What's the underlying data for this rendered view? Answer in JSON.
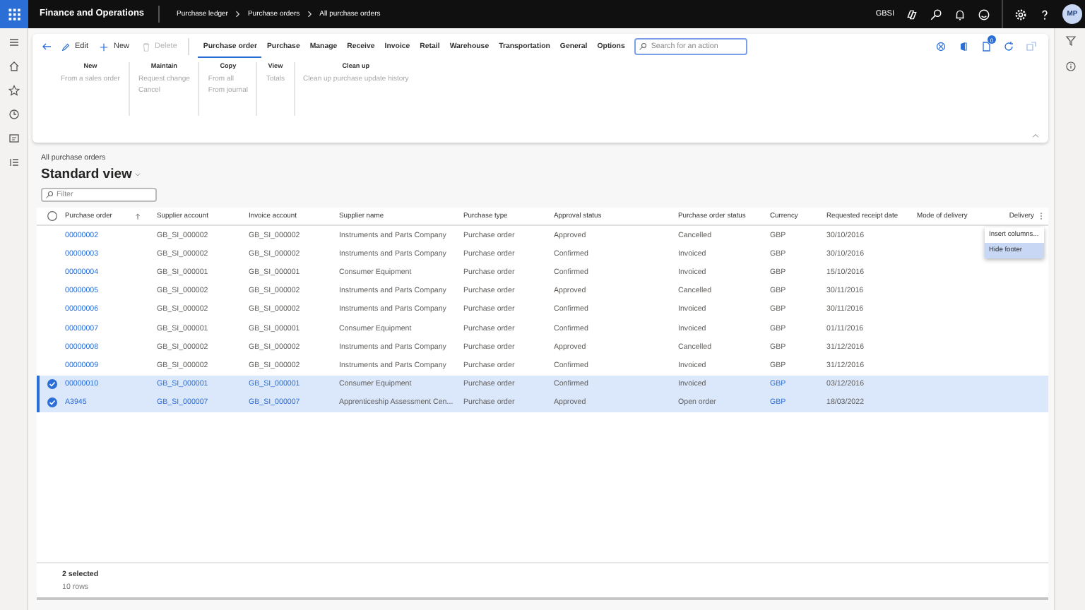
{
  "app_bar": {
    "app_name": "Finance and Operations",
    "breadcrumb": [
      "Purchase ledger",
      "Purchase orders",
      "All purchase orders"
    ],
    "company": "GBSI",
    "avatar": "MP",
    "notification_count": "0"
  },
  "action_pane": {
    "commands": [
      {
        "kind": "edit",
        "label": "Edit",
        "disabled": false
      },
      {
        "kind": "new",
        "label": "New",
        "disabled": false
      },
      {
        "kind": "delete",
        "label": "Delete",
        "disabled": true
      }
    ],
    "tabs": [
      {
        "label": "Purchase order",
        "selected": true
      },
      {
        "label": "Purchase",
        "selected": false
      },
      {
        "label": "Manage",
        "selected": false
      },
      {
        "label": "Receive",
        "selected": false
      },
      {
        "label": "Invoice",
        "selected": false
      },
      {
        "label": "Retail",
        "selected": false
      },
      {
        "label": "Warehouse",
        "selected": false
      },
      {
        "label": "Transportation",
        "selected": false
      },
      {
        "label": "General",
        "selected": false
      },
      {
        "label": "Options",
        "selected": false
      }
    ],
    "search": {
      "placeholder": "Search for an action"
    },
    "groups": [
      {
        "title": "New",
        "items": [
          {
            "label": "From a sales order",
            "disabled": true
          }
        ]
      },
      {
        "title": "Maintain",
        "items": [
          {
            "label": "Request change",
            "disabled": true
          },
          {
            "label": "Cancel",
            "disabled": true
          }
        ]
      },
      {
        "title": "Copy",
        "items": [
          {
            "label": "From all",
            "disabled": true
          },
          {
            "label": "From journal",
            "disabled": true
          }
        ]
      },
      {
        "title": "View",
        "items": [
          {
            "label": "Totals",
            "disabled": true
          }
        ]
      },
      {
        "title": "Clean up",
        "items": [
          {
            "label": "Clean up purchase update history",
            "disabled": true
          }
        ]
      }
    ]
  },
  "page": {
    "caption": "All purchase orders",
    "view": "Standard view",
    "filter": {
      "placeholder": "Filter"
    }
  },
  "grid": {
    "all_checked": false,
    "columns": [
      {
        "label": "Purchase order",
        "sorted": true
      },
      {
        "label": "Supplier account"
      },
      {
        "label": "Invoice account"
      },
      {
        "label": "Supplier name"
      },
      {
        "label": "Purchase type"
      },
      {
        "label": "Approval status"
      },
      {
        "label": "Purchase order status"
      },
      {
        "label": "Currency"
      },
      {
        "label": "Requested receipt date"
      },
      {
        "label": "Mode of delivery"
      },
      {
        "label": "Delivery"
      }
    ],
    "rows": [
      {
        "selected": false,
        "cells": [
          "00000002",
          "GB_SI_000002",
          "GB_SI_000002",
          "Instruments and Parts Company",
          "Purchase order",
          "Approved",
          "Cancelled",
          "GBP",
          "30/10/2016"
        ]
      },
      {
        "selected": false,
        "cells": [
          "00000003",
          "GB_SI_000002",
          "GB_SI_000002",
          "Instruments and Parts Company",
          "Purchase order",
          "Confirmed",
          "Invoiced",
          "GBP",
          "30/10/2016"
        ]
      },
      {
        "selected": false,
        "cells": [
          "00000004",
          "GB_SI_000001",
          "GB_SI_000001",
          "Consumer Equipment",
          "Purchase order",
          "Confirmed",
          "Invoiced",
          "GBP",
          "15/10/2016"
        ]
      },
      {
        "selected": false,
        "cells": [
          "00000005",
          "GB_SI_000002",
          "GB_SI_000002",
          "Instruments and Parts Company",
          "Purchase order",
          "Approved",
          "Cancelled",
          "GBP",
          "30/11/2016"
        ]
      },
      {
        "selected": false,
        "cells": [
          "00000006",
          "GB_SI_000002",
          "GB_SI_000002",
          "Instruments and Parts Company",
          "Purchase order",
          "Confirmed",
          "Invoiced",
          "GBP",
          "30/11/2016"
        ]
      },
      {
        "selected": false,
        "cells": [
          "00000007",
          "GB_SI_000001",
          "GB_SI_000001",
          "Consumer Equipment",
          "Purchase order",
          "Confirmed",
          "Invoiced",
          "GBP",
          "01/11/2016"
        ]
      },
      {
        "selected": false,
        "cells": [
          "00000008",
          "GB_SI_000002",
          "GB_SI_000002",
          "Instruments and Parts Company",
          "Purchase order",
          "Approved",
          "Cancelled",
          "GBP",
          "31/12/2016"
        ]
      },
      {
        "selected": false,
        "cells": [
          "00000009",
          "GB_SI_000002",
          "GB_SI_000002",
          "Instruments and Parts Company",
          "Purchase order",
          "Confirmed",
          "Invoiced",
          "GBP",
          "31/12/2016"
        ]
      },
      {
        "selected": true,
        "cells": [
          "00000010",
          "GB_SI_000001",
          "GB_SI_000001",
          "Consumer Equipment",
          "Purchase order",
          "Confirmed",
          "Invoiced",
          "GBP",
          "03/12/2016"
        ]
      },
      {
        "selected": true,
        "cells": [
          "A3945",
          "GB_SI_000007",
          "GB_SI_000007",
          "Apprenticeship Assessment Cen...",
          "Purchase order",
          "Approved",
          "Open order",
          "GBP",
          "18/03/2022"
        ]
      }
    ],
    "context_menu": [
      {
        "label": "Insert columns...",
        "selected": false
      },
      {
        "label": "Hide footer",
        "selected": true
      }
    ],
    "footer": {
      "selection": "2 selected",
      "count": "10 rows"
    }
  }
}
